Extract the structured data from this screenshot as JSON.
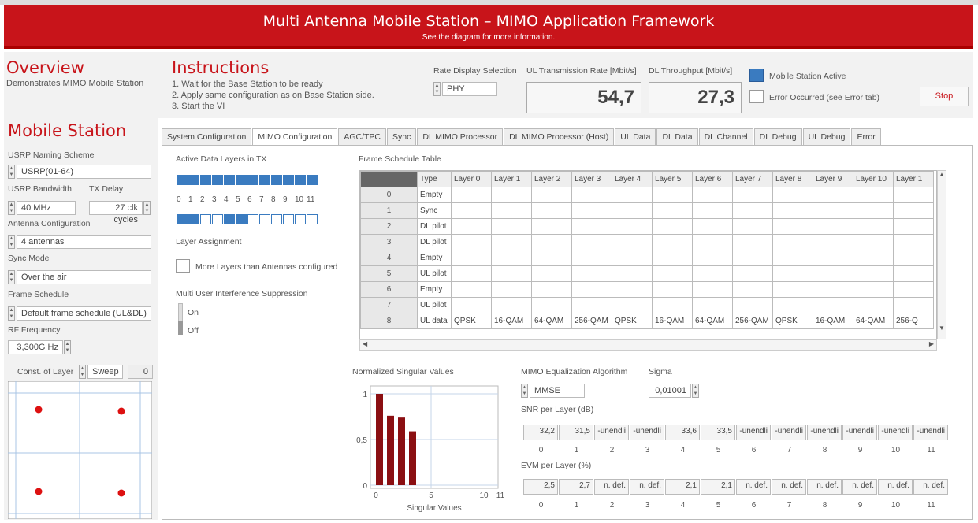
{
  "banner": {
    "title": "Multi Antenna Mobile Station – MIMO Application Framework",
    "subtitle": "See the diagram for more information."
  },
  "overview": {
    "title": "Overview",
    "desc": "Demonstrates MIMO Mobile Station"
  },
  "instructions": {
    "title": "Instructions",
    "steps": [
      "1. Wait for the Base Station to be ready",
      "2. Apply same configuration as on Base Station side.",
      "3. Start the VI"
    ]
  },
  "rate_display": {
    "label": "Rate Display Selection",
    "value": "PHY"
  },
  "ul_rate": {
    "label": "UL Transmission Rate [Mbit/s]",
    "value": "54,7"
  },
  "dl_tp": {
    "label": "DL Throughput [Mbit/s]",
    "value": "27,3"
  },
  "status": {
    "active_label": "Mobile Station Active",
    "active": true,
    "error_label": "Error Occurred (see Error tab)",
    "error": false
  },
  "stop_label": "Stop",
  "ms": {
    "title": "Mobile Station",
    "usrp_label": "USRP Naming Scheme",
    "usrp_value": "USRP(01-64)",
    "bw_label": "USRP Bandwidth",
    "bw_value": "40 MHz",
    "txd_label": "TX Delay",
    "txd_value": "27 clk cycles",
    "ant_label": "Antenna Configuration",
    "ant_value": "4 antennas",
    "sync_label": "Sync Mode",
    "sync_value": "Over the air",
    "fs_label": "Frame Schedule",
    "fs_value": "Default frame schedule (UL&DL)",
    "rf_label": "RF Frequency",
    "rf_value": "3,300G Hz",
    "const_label": "Const. of Layer",
    "sweep_label": "Sweep",
    "const_value": "0"
  },
  "tabs": [
    "System Configuration",
    "MIMO Configuration",
    "AGC/TPC",
    "Sync",
    "DL MIMO Processor",
    "DL MIMO Processor (Host)",
    "UL Data",
    "DL Data",
    "DL Channel",
    "DL Debug",
    "UL Debug",
    "Error"
  ],
  "active_tab": 1,
  "mimo": {
    "active_layers_label": "Active Data Layers in TX",
    "layer_nums": [
      "0",
      "1",
      "2",
      "3",
      "4",
      "5",
      "6",
      "7",
      "8",
      "9",
      "10",
      "11"
    ],
    "assign_label": "Layer Assignment",
    "assignment": [
      1,
      1,
      0,
      0,
      1,
      1,
      0,
      0,
      0,
      0,
      0,
      0
    ],
    "more_layers_label": "More Layers than Antennas configured",
    "muis_label": "Multi User Interference Suppression",
    "on_label": "On",
    "off_label": "Off"
  },
  "schedule": {
    "title": "Frame Schedule Table",
    "headers": [
      "Type",
      "Layer 0",
      "Layer 1",
      "Layer 2",
      "Layer 3",
      "Layer 4",
      "Layer 5",
      "Layer 6",
      "Layer 7",
      "Layer 8",
      "Layer 9",
      "Layer 10",
      "Layer 1"
    ],
    "rows": [
      {
        "idx": "0",
        "type": "Empty",
        "cells": []
      },
      {
        "idx": "1",
        "type": "Sync",
        "cells": []
      },
      {
        "idx": "2",
        "type": "DL pilot",
        "cells": []
      },
      {
        "idx": "3",
        "type": "DL pilot",
        "cells": []
      },
      {
        "idx": "4",
        "type": "Empty",
        "cells": []
      },
      {
        "idx": "5",
        "type": "UL pilot",
        "cells": []
      },
      {
        "idx": "6",
        "type": "Empty",
        "cells": []
      },
      {
        "idx": "7",
        "type": "UL pilot",
        "cells": []
      },
      {
        "idx": "8",
        "type": "UL data",
        "cells": [
          "QPSK",
          "16-QAM",
          "64-QAM",
          "256-QAM",
          "QPSK",
          "16-QAM",
          "64-QAM",
          "256-QAM",
          "QPSK",
          "16-QAM",
          "64-QAM",
          "256-Q"
        ]
      }
    ]
  },
  "nsv": {
    "title": "Normalized Singular Values",
    "xlabel": "Singular Values",
    "yticks": [
      "1",
      "0,5",
      "0"
    ],
    "xticks": [
      "0",
      "5",
      "10",
      "11"
    ],
    "values": [
      1,
      0.76,
      0.74,
      0.59
    ]
  },
  "eq": {
    "label": "MIMO Equalization Algorithm",
    "value": "MMSE",
    "sigma_label": "Sigma",
    "sigma_value": "0,01001"
  },
  "snr": {
    "label": "SNR per Layer (dB)",
    "values": [
      "32,2",
      "31,5",
      "-unendli",
      "-unendli",
      "33,6",
      "33,5",
      "-unendli",
      "-unendli",
      "-unendli",
      "-unendli",
      "-unendli",
      "-unendli"
    ]
  },
  "evm": {
    "label": "EVM per Layer (%)",
    "values": [
      "2,5",
      "2,7",
      "n. def.",
      "n. def.",
      "2,1",
      "2,1",
      "n. def.",
      "n. def.",
      "n. def.",
      "n. def.",
      "n. def.",
      "n. def."
    ]
  },
  "layer_idx": [
    "0",
    "1",
    "2",
    "3",
    "4",
    "5",
    "6",
    "7",
    "8",
    "9",
    "10",
    "11"
  ],
  "colors": {
    "brand": "#c8141a",
    "led": "#3a7bc0",
    "bar": "#8b0f12"
  }
}
